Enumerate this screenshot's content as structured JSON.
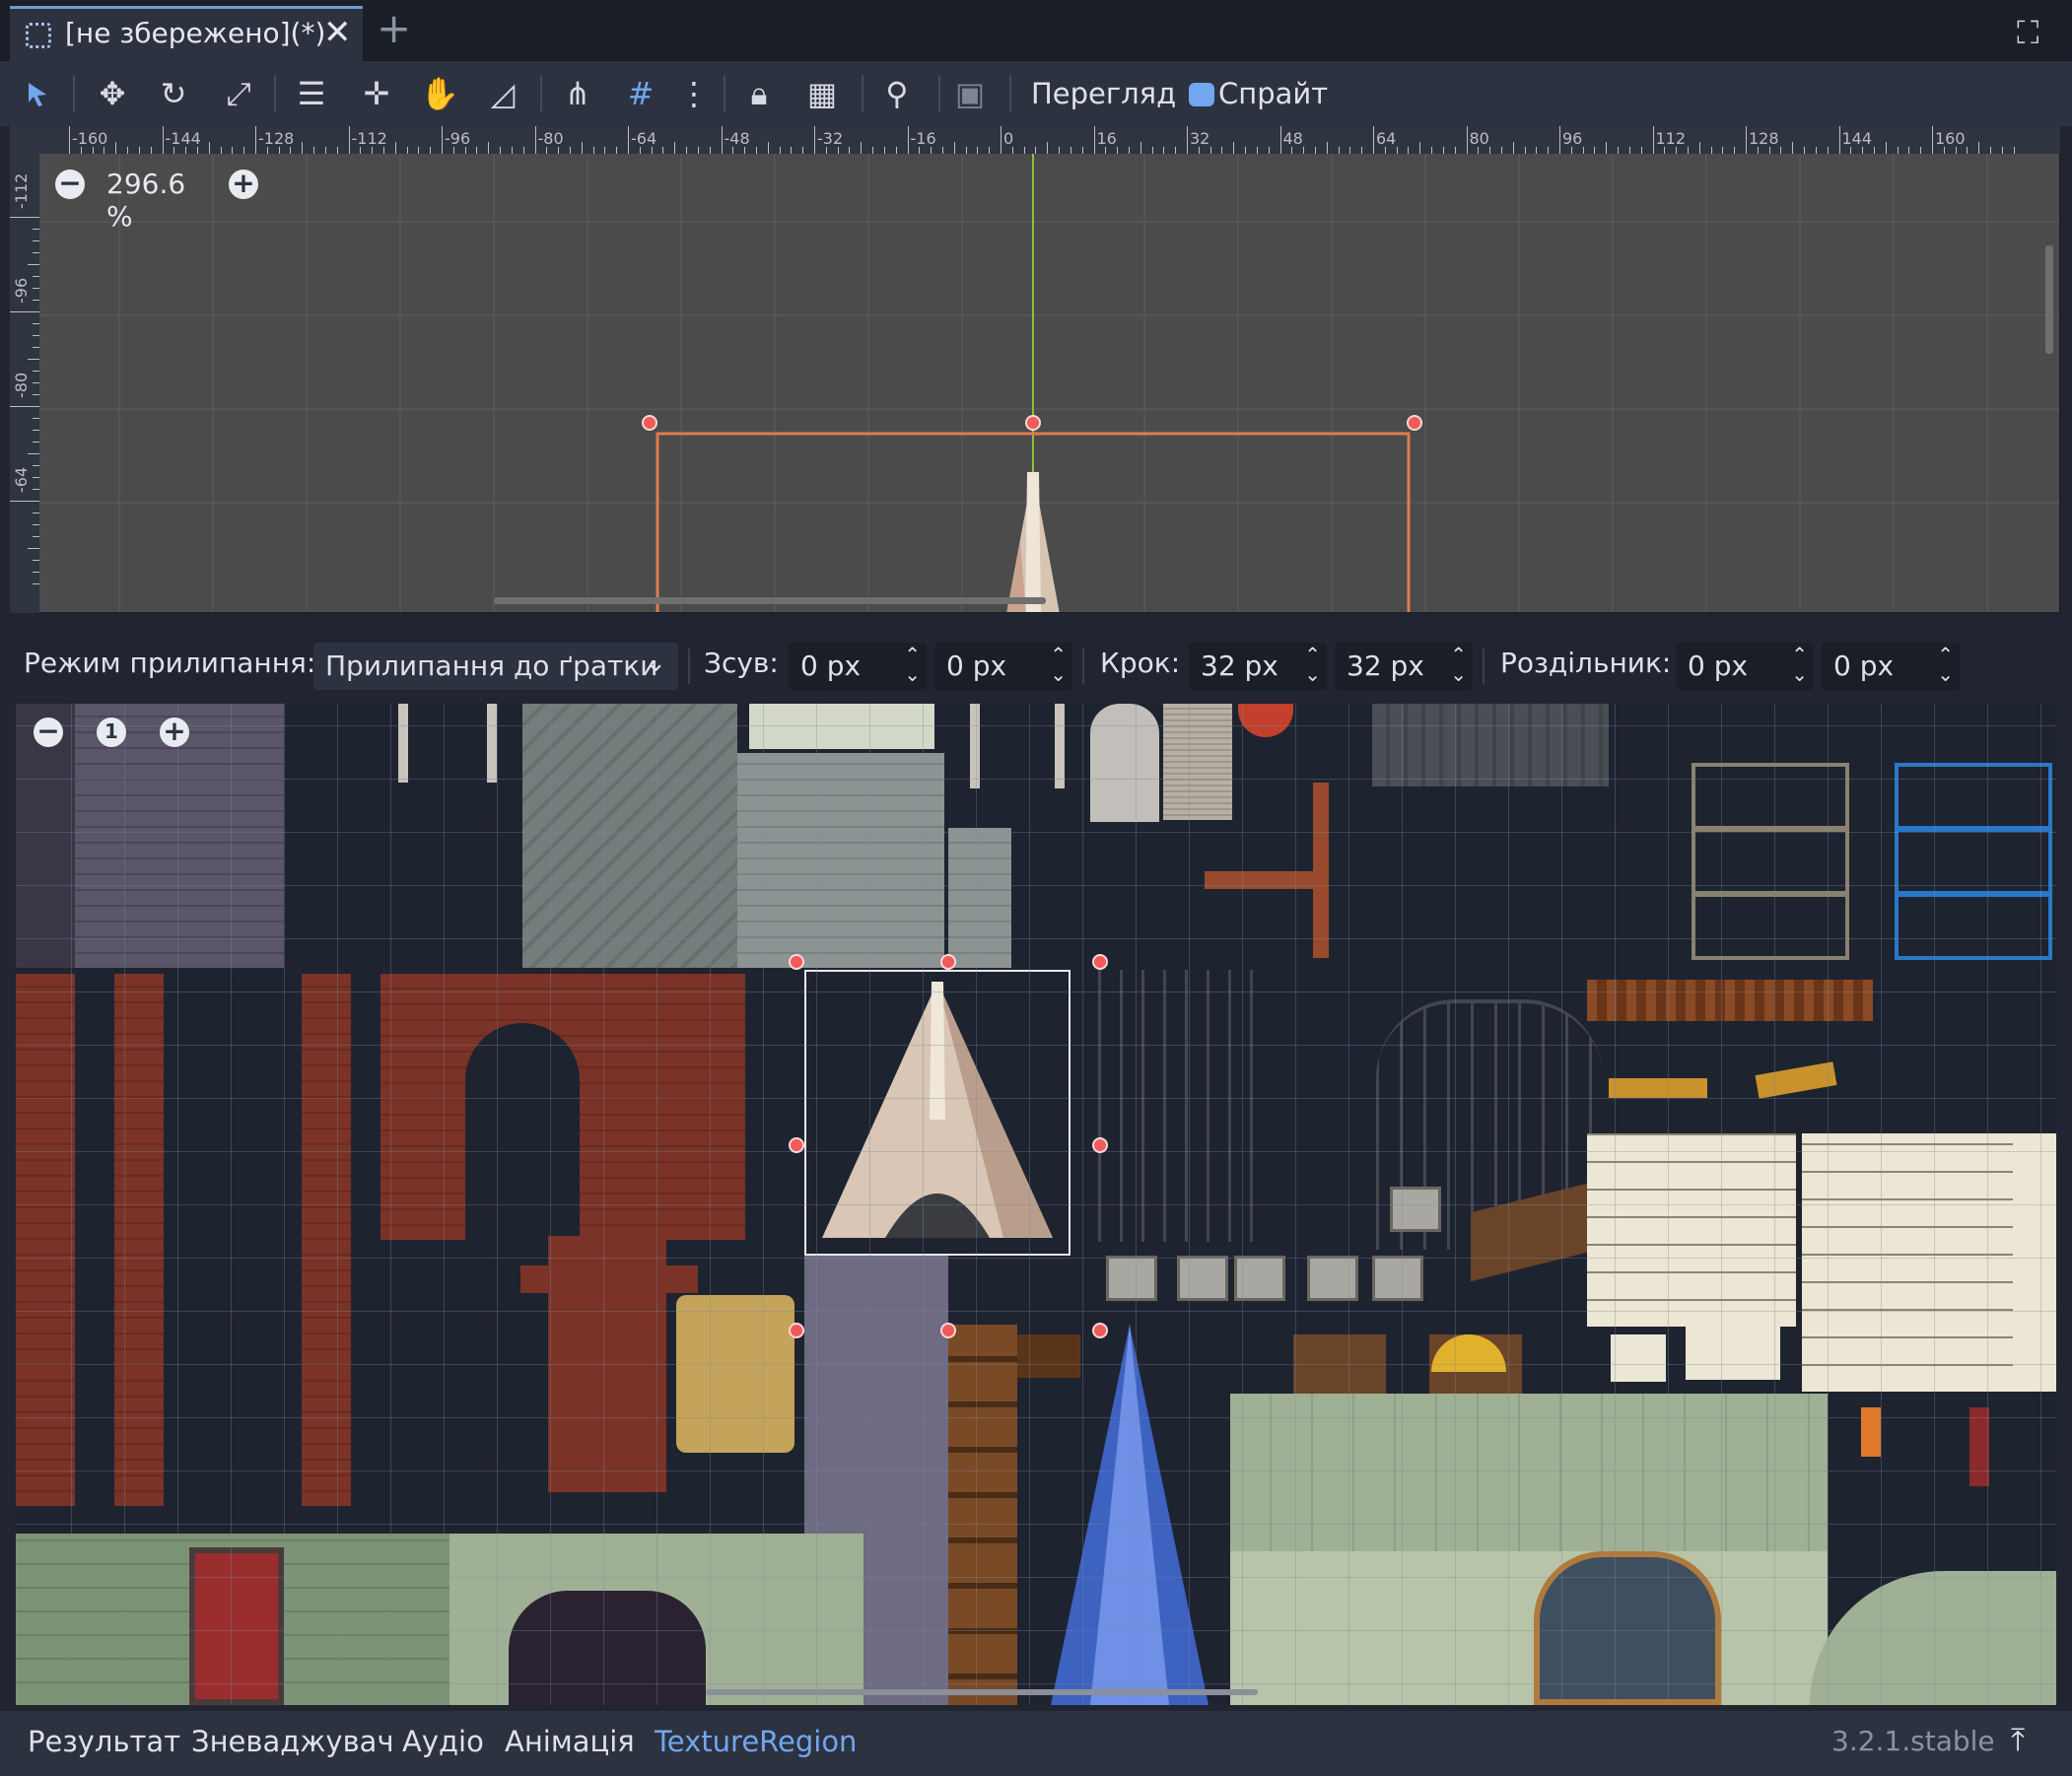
{
  "tab": {
    "title": "[не збережено](*)",
    "close": "✕",
    "add": "+"
  },
  "toolbar": {
    "view_menu": "Перегляд",
    "sprite_menu": "Спрайт",
    "icons": [
      "select-icon",
      "move-icon",
      "rotate-icon",
      "scale-icon",
      "list-select-icon",
      "pivot-icon",
      "pan-icon",
      "ruler-icon",
      "smart-snap-icon",
      "grid-snap-icon",
      "more-icon",
      "lock-icon",
      "group-icon",
      "bone-icon",
      "camera-icon"
    ]
  },
  "viewport": {
    "zoom": "296.6 %",
    "hruler_labels": [
      "-160",
      "-144",
      "-128",
      "-112",
      "-96",
      "-80",
      "-64",
      "-48",
      "-32",
      "-16",
      "0",
      "16",
      "32",
      "48",
      "64",
      "80",
      "96",
      "112",
      "128",
      "144",
      "160"
    ],
    "vruler_labels": [
      "-112",
      "-96",
      "-80",
      "-64"
    ]
  },
  "snapbar": {
    "mode_label": "Режим прилипання:",
    "mode_value": "Прилипання до ґратки",
    "offset_label": "Зсув:",
    "offset_x": "0 px",
    "offset_y": "0 px",
    "step_label": "Крок:",
    "step_x": "32 px",
    "step_y": "32 px",
    "sep_label": "Роздільник:",
    "sep_x": "0 px",
    "sep_y": "0 px"
  },
  "atlas": {
    "zoom_reset": "1"
  },
  "bottom": {
    "tabs": [
      "Результат",
      "Зневаджувач",
      "Аудіо",
      "Анімація",
      "TextureRegion"
    ],
    "active_tab": "TextureRegion",
    "version": "3.2.1.stable"
  },
  "colors": {
    "accent": "#72a6ee",
    "selection": "#e07b4f",
    "handle": "#f05a5a",
    "panel": "#2c3240",
    "background": "#202531"
  }
}
